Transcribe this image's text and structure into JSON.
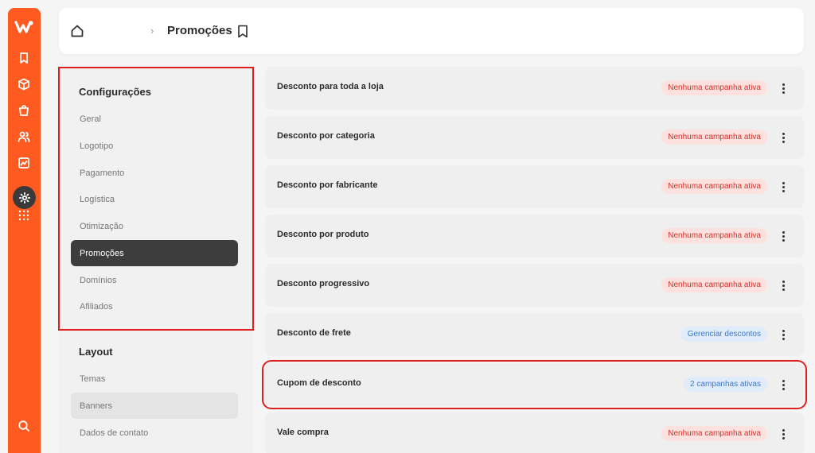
{
  "header": {
    "title": "Promoções",
    "separator": "›"
  },
  "rail": {
    "icons": [
      "logo-icon",
      "bookmark-icon",
      "box-icon",
      "bag-icon",
      "users-icon",
      "chart-icon",
      "gear-icon",
      "grid-icon",
      "search-icon"
    ]
  },
  "nav": {
    "section1": "Configurações",
    "items1": [
      "Geral",
      "Logotipo",
      "Pagamento",
      "Logística",
      "Otimização",
      "Promoções",
      "Domínios",
      "Afiliados"
    ],
    "section2": "Layout",
    "items2": [
      "Temas",
      "Banners",
      "Dados de contato"
    ]
  },
  "promotions": [
    {
      "title": "Desconto para toda a loja",
      "status": "Nenhuma campanha ativa",
      "tone": "red"
    },
    {
      "title": "Desconto por categoria",
      "status": "Nenhuma campanha ativa",
      "tone": "red"
    },
    {
      "title": "Desconto por fabricante",
      "status": "Nenhuma campanha ativa",
      "tone": "red"
    },
    {
      "title": "Desconto por produto",
      "status": "Nenhuma campanha ativa",
      "tone": "red"
    },
    {
      "title": "Desconto progressivo",
      "status": "Nenhuma campanha ativa",
      "tone": "red"
    },
    {
      "title": "Desconto de frete",
      "status": "Gerenciar descontos",
      "tone": "blue"
    },
    {
      "title": "Cupom de desconto",
      "status": "2 campanhas ativas",
      "tone": "blue"
    },
    {
      "title": "Vale compra",
      "status": "Nenhuma campanha ativa",
      "tone": "red"
    }
  ],
  "colors": {
    "brand": "#ff5a1f",
    "active_nav": "#3d3d3d",
    "highlight": "#e0201e"
  }
}
